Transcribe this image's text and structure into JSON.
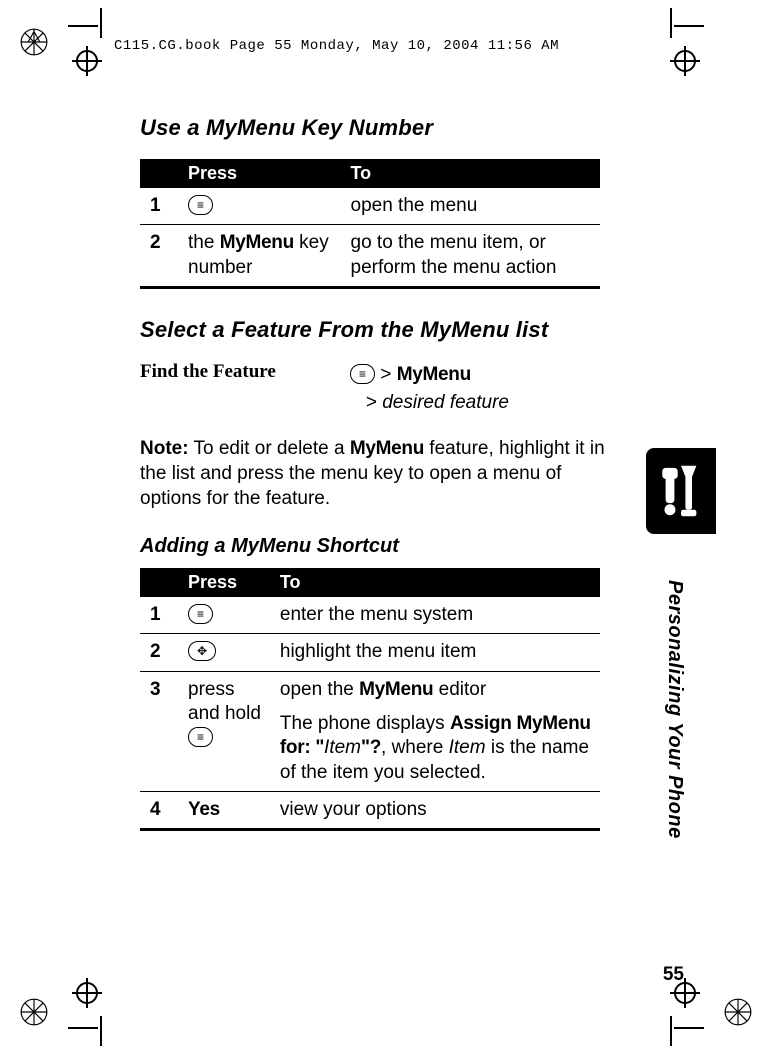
{
  "header_timestamp": "C115.CG.book  Page 55  Monday, May 10, 2004  11:56 AM",
  "section1_title": "Use a MyMenu Key Number",
  "table1": {
    "head_press": "Press",
    "head_to": "To",
    "rows": [
      {
        "num": "1",
        "press_type": "menu-key",
        "to": "open the menu"
      },
      {
        "num": "2",
        "press_prefix": "the ",
        "press_bold": "MyMenu",
        "press_suffix": " key number",
        "to": "go to the menu item, or perform the menu action"
      }
    ]
  },
  "section2_title": "Select a Feature From the MyMenu list",
  "find_feature_label": "Find the Feature",
  "find_feature_path": {
    "sep": ">",
    "mymenu": "MyMenu",
    "line2_prefix": "> ",
    "line2_italic": "desired feature"
  },
  "note_prefix": "Note:",
  "note_a": " To edit or delete a ",
  "note_bold": "MyMenu",
  "note_b": " feature, highlight it in the list and press the menu key to open a menu of options for the feature.",
  "section3_title": "Adding a MyMenu Shortcut",
  "table2": {
    "head_press": "Press",
    "head_to": "To",
    "rows": [
      {
        "num": "1",
        "press_type": "menu-key",
        "to": "enter the menu system"
      },
      {
        "num": "2",
        "press_type": "nav-key",
        "to": "highlight the menu item"
      },
      {
        "num": "3",
        "press_text": "press and hold",
        "press_second_line_type": "menu-key",
        "to_line1_a": "open the ",
        "to_line1_bold": "MyMenu",
        "to_line1_b": " editor",
        "to_line2_a": "The phone displays ",
        "to_line2_bold": "Assign MyMenu for: \"",
        "to_line2_italic": "Item",
        "to_line2_bold2": "\"?",
        "to_line2_b": ", where ",
        "to_line2_italic2": "Item",
        "to_line2_c": " is the name of the item you selected."
      },
      {
        "num": "4",
        "press_bold": "Yes",
        "to": "view your options"
      }
    ]
  },
  "vertical_label": "Personalizing Your Phone",
  "page_number": "55",
  "icons": {
    "menu_key": "≡",
    "nav_key": "✥"
  }
}
